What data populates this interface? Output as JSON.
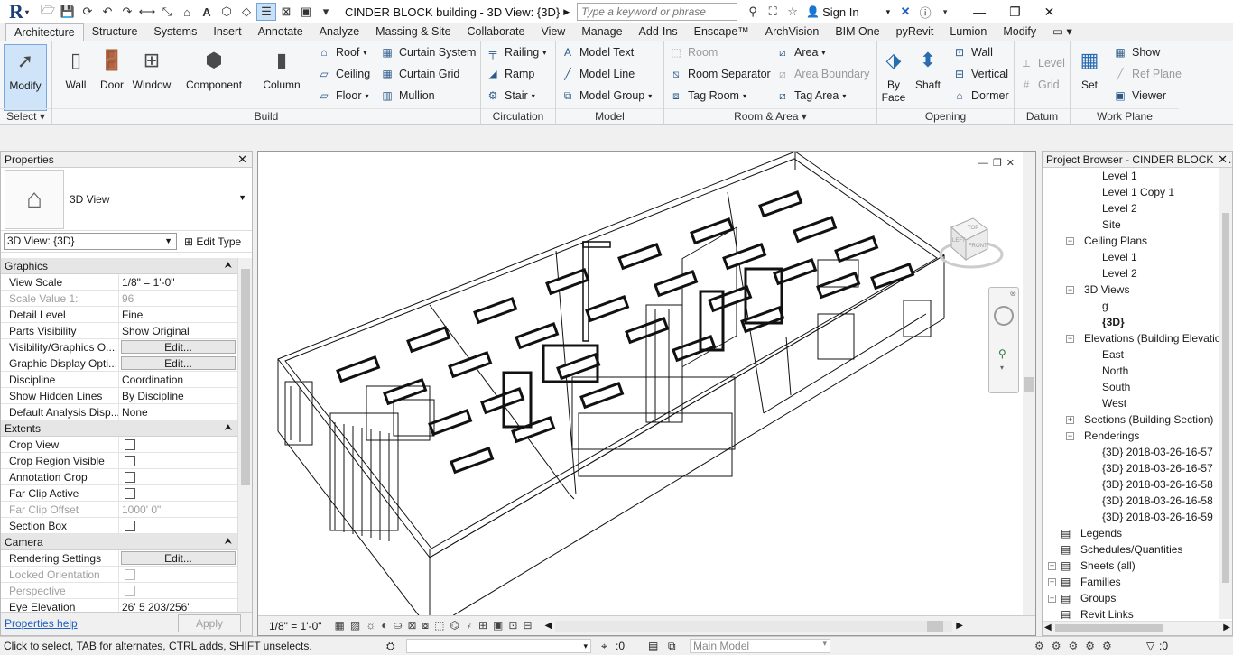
{
  "app": {
    "title": "CINDER BLOCK building - 3D View: {3D}",
    "search_placeholder": "Type a keyword or phrase",
    "sign_in": "Sign In",
    "logo": "R"
  },
  "tabs": [
    "Architecture",
    "Structure",
    "Systems",
    "Insert",
    "Annotate",
    "Analyze",
    "Massing & Site",
    "Collaborate",
    "View",
    "Manage",
    "Add-Ins",
    "Enscape™",
    "ArchVision",
    "BIM One",
    "pyRevit",
    "Lumion",
    "Modify"
  ],
  "ribbon": {
    "select": {
      "modify": "Modify",
      "label": "Select ▾"
    },
    "build": {
      "label": "Build",
      "wall": "Wall",
      "door": "Door",
      "window": "Window",
      "component": "Component",
      "column": "Column",
      "roof": "Roof",
      "ceiling": "Ceiling",
      "floor": "Floor",
      "curtain_system": "Curtain System",
      "curtain_grid": "Curtain Grid",
      "mullion": "Mullion"
    },
    "circulation": {
      "label": "Circulation",
      "railing": "Railing",
      "ramp": "Ramp",
      "stair": "Stair"
    },
    "model": {
      "label": "Model",
      "text": "Model Text",
      "line": "Model Line",
      "group": "Model Group"
    },
    "room": {
      "label": "Room & Area ▾",
      "room": "Room",
      "room_sep": "Room Separator",
      "tag_room": "Tag Room",
      "area": "Area",
      "area_boundary": "Area Boundary",
      "tag_area": "Tag Area"
    },
    "opening": {
      "label": "Opening",
      "by_face": "By Face",
      "shaft": "Shaft",
      "wall": "Wall",
      "vertical": "Vertical",
      "dormer": "Dormer"
    },
    "datum": {
      "label": "Datum",
      "level": "Level",
      "grid": "Grid"
    },
    "workplane": {
      "label": "Work Plane",
      "set": "Set",
      "show": "Show",
      "ref_plane": "Ref Plane",
      "viewer": "Viewer"
    }
  },
  "properties": {
    "title": "Properties",
    "type_name": "3D View",
    "selector": "3D View: {3D}",
    "edit_type": "Edit Type",
    "categories": [
      {
        "name": "Graphics",
        "rows": [
          {
            "k": "View Scale",
            "v": "1/8\" = 1'-0\""
          },
          {
            "k": "Scale Value    1:",
            "v": "96",
            "dis": true
          },
          {
            "k": "Detail Level",
            "v": "Fine"
          },
          {
            "k": "Parts Visibility",
            "v": "Show Original"
          },
          {
            "k": "Visibility/Graphics O...",
            "v": "Edit...",
            "btn": true
          },
          {
            "k": "Graphic Display Opti...",
            "v": "Edit...",
            "btn": true
          },
          {
            "k": "Discipline",
            "v": "Coordination"
          },
          {
            "k": "Show Hidden Lines",
            "v": "By Discipline"
          },
          {
            "k": "Default Analysis Disp...",
            "v": "None"
          }
        ]
      },
      {
        "name": "Extents",
        "rows": [
          {
            "k": "Crop View",
            "chk": true
          },
          {
            "k": "Crop Region Visible",
            "chk": true
          },
          {
            "k": "Annotation Crop",
            "chk": true
          },
          {
            "k": "Far Clip Active",
            "chk": true
          },
          {
            "k": "Far Clip Offset",
            "v": "1000'  0\"",
            "dis": true
          },
          {
            "k": "Section Box",
            "chk": true
          }
        ]
      },
      {
        "name": "Camera",
        "rows": [
          {
            "k": "Rendering Settings",
            "v": "Edit...",
            "btn": true
          },
          {
            "k": "Locked Orientation",
            "chk": true,
            "dis": true
          },
          {
            "k": "Perspective",
            "chk": true,
            "dis": true
          },
          {
            "k": "Eye Elevation",
            "v": "26'  5 203/256\""
          }
        ]
      }
    ],
    "help": "Properties help",
    "apply": "Apply"
  },
  "view": {
    "scale": "1/8\" = 1'-0\"",
    "cube_top": "TOP",
    "cube_front": "FRONT",
    "cube_left": "LEFT"
  },
  "browser": {
    "title": "Project Browser - CINDER BLOCK b...",
    "items": [
      {
        "t": "Level 1",
        "lv": 3
      },
      {
        "t": "Level 1 Copy 1",
        "lv": 3
      },
      {
        "t": "Level 2",
        "lv": 3
      },
      {
        "t": "Site",
        "lv": 3
      },
      {
        "t": "Ceiling Plans",
        "lv": 2,
        "tog": "−"
      },
      {
        "t": "Level 1",
        "lv": 3
      },
      {
        "t": "Level 2",
        "lv": 3
      },
      {
        "t": "3D Views",
        "lv": 2,
        "tog": "−"
      },
      {
        "t": "g",
        "lv": 3
      },
      {
        "t": "{3D}",
        "lv": 3,
        "bold": true
      },
      {
        "t": "Elevations (Building Elevatio",
        "lv": 2,
        "tog": "−"
      },
      {
        "t": "East",
        "lv": 3
      },
      {
        "t": "North",
        "lv": 3
      },
      {
        "t": "South",
        "lv": 3
      },
      {
        "t": "West",
        "lv": 3
      },
      {
        "t": "Sections (Building Section)",
        "lv": 2,
        "tog": "+"
      },
      {
        "t": "Renderings",
        "lv": 2,
        "tog": "−"
      },
      {
        "t": "{3D} 2018-03-26-16-57",
        "lv": 3
      },
      {
        "t": "{3D} 2018-03-26-16-57",
        "lv": 3
      },
      {
        "t": "{3D} 2018-03-26-16-58",
        "lv": 3
      },
      {
        "t": "{3D} 2018-03-26-16-58",
        "lv": 3
      },
      {
        "t": "{3D} 2018-03-26-16-59",
        "lv": 3
      },
      {
        "t": "Legends",
        "lv": 1
      },
      {
        "t": "Schedules/Quantities",
        "lv": 1
      },
      {
        "t": "Sheets (all)",
        "lv": 1,
        "tog": "+"
      },
      {
        "t": "Families",
        "lv": 1,
        "tog": "+"
      },
      {
        "t": "Groups",
        "lv": 1,
        "tog": "+"
      },
      {
        "t": "Revit Links",
        "lv": 1
      }
    ]
  },
  "status": {
    "hint": "Click to select, TAB for alternates, CTRL adds, SHIFT unselects.",
    "workset": ":0",
    "model": "Main Model",
    "filter": ":0"
  }
}
